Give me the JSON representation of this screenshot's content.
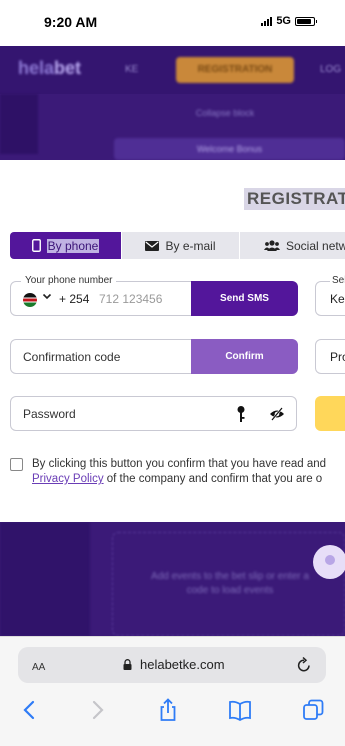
{
  "status_bar": {
    "time": "9:20 AM",
    "network": "5G"
  },
  "site": {
    "logo_a": "hela",
    "logo_b": "bet",
    "lang": "KE",
    "registration_button": "REGISTRATION",
    "login": "LOG",
    "collapse_block": "Collapse block",
    "bonus_text": "Welcome Bonus",
    "betslip_text": "Add events to the bet slip or enter a code to load events"
  },
  "modal": {
    "title": "REGISTRATIO",
    "tabs": [
      {
        "label": "By phone",
        "icon": "phone-icon",
        "active": true
      },
      {
        "label": "By e-mail",
        "icon": "envelope-icon",
        "active": false
      },
      {
        "label": "Social netw",
        "icon": "users-icon",
        "active": false
      }
    ],
    "phone": {
      "label": "Your phone number",
      "country_code": "+ 254",
      "placeholder": "712 123456",
      "send_button": "Send SMS"
    },
    "country_select": {
      "label": "Sel",
      "value": "Ken"
    },
    "confirmation": {
      "label": "Confirmation code",
      "button": "Confirm"
    },
    "promo": {
      "value": "Pro"
    },
    "password": {
      "label": "Password"
    },
    "consent": {
      "line1": "By clicking this button you confirm that you have read and",
      "link": "Privacy Policy",
      "line2_rest": " of the company and confirm that you are o"
    }
  },
  "browser": {
    "text_size": "AA",
    "url": "helabetke.com"
  },
  "colors": {
    "primary": "#53169b",
    "confirm": "#8a5cc2",
    "accent_yellow": "#ffd75a",
    "site_bg": "#3b1a78"
  }
}
